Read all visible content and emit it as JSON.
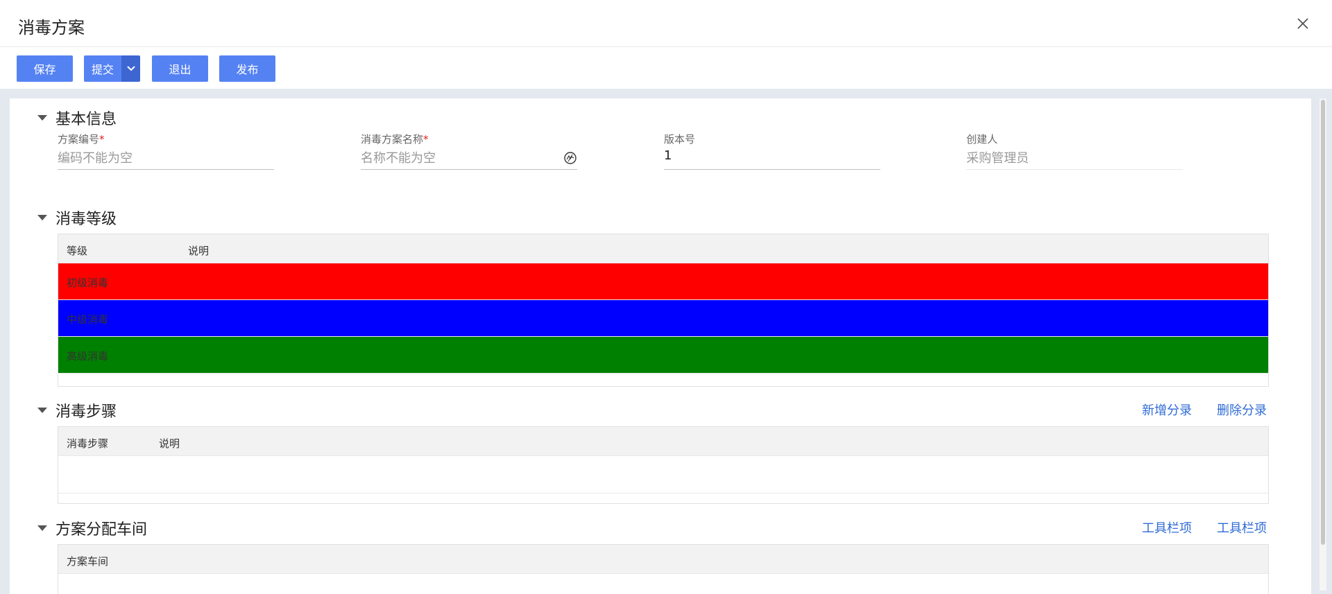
{
  "dialog": {
    "title": "消毒方案"
  },
  "toolbar": {
    "save": "保存",
    "submit": "提交",
    "exit": "退出",
    "publish": "发布"
  },
  "basic_info": {
    "title": "基本信息",
    "code": {
      "label": "方案编号",
      "required": "*",
      "placeholder": "编码不能为空"
    },
    "name": {
      "label": "消毒方案名称",
      "required": "*",
      "placeholder": "名称不能为空"
    },
    "version": {
      "label": "版本号",
      "value": "1"
    },
    "creator": {
      "label": "创建人",
      "value": "采购管理员"
    }
  },
  "levels": {
    "title": "消毒等级",
    "columns": [
      "等级",
      "说明"
    ],
    "rows": [
      {
        "level": "初级消毒",
        "color": "#ff0000"
      },
      {
        "level": "中级消毒",
        "color": "#0000ff"
      },
      {
        "level": "高级消毒",
        "color": "#008000"
      }
    ]
  },
  "steps": {
    "title": "消毒步骤",
    "columns": [
      "消毒步骤",
      "说明"
    ],
    "actions": [
      "新增分录",
      "删除分录"
    ]
  },
  "workshop": {
    "title": "方案分配车间",
    "columns": [
      "方案车间"
    ],
    "actions": [
      "工具栏项",
      "工具栏项"
    ]
  },
  "colors": {
    "primary": "#5582f3",
    "primary_dark": "#3e66d1",
    "link": "#2f6bd6",
    "required": "#e02020"
  }
}
